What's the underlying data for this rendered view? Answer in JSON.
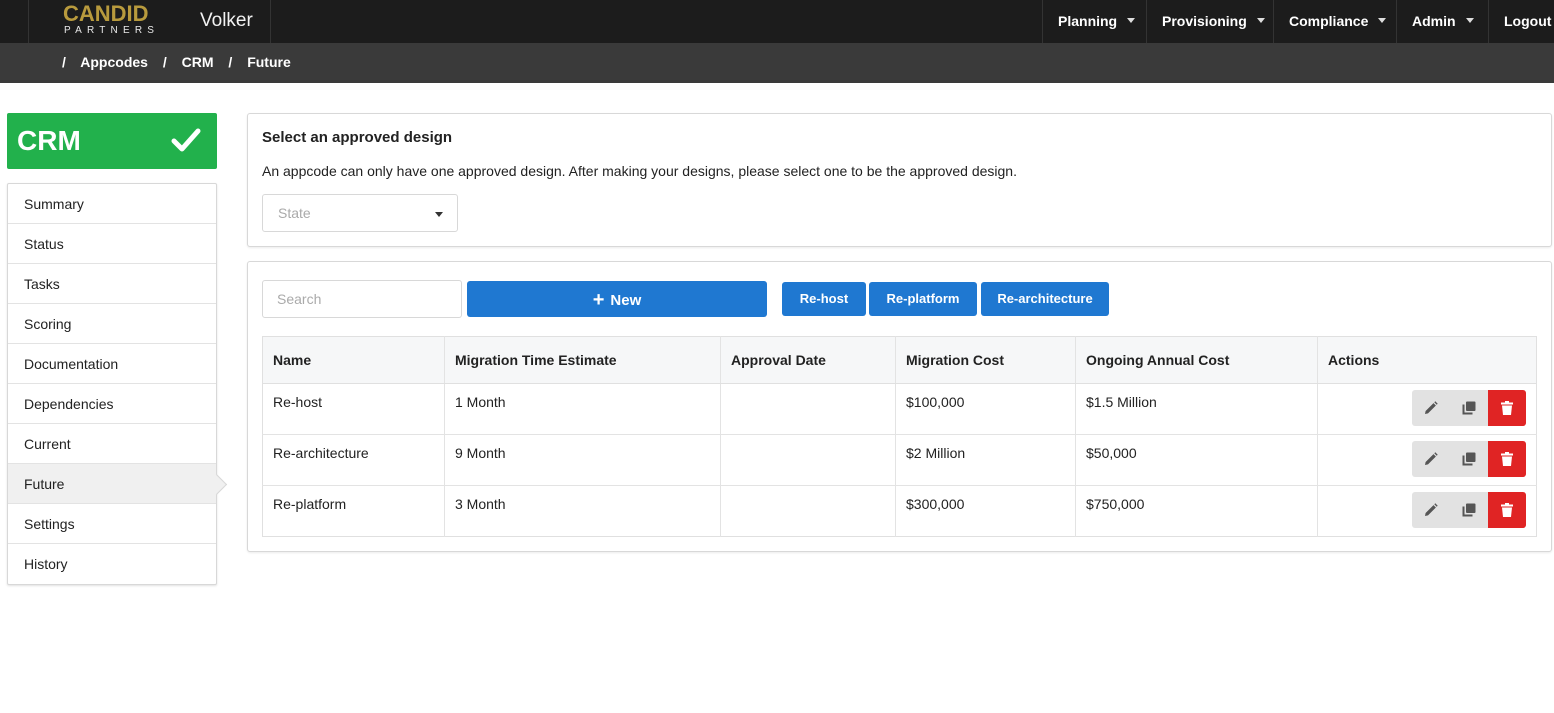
{
  "brand": {
    "logo_top": "CANDID",
    "logo_bottom": "PARTNERS",
    "app_name": "Volker"
  },
  "nav": {
    "items": [
      "Planning",
      "Provisioning",
      "Compliance",
      "Admin"
    ],
    "logout": "Logout"
  },
  "breadcrumb": [
    "Appcodes",
    "CRM",
    "Future"
  ],
  "app_badge": {
    "name": "CRM",
    "status_icon": "check-icon",
    "color": "#22b14c"
  },
  "sidebar": {
    "items": [
      {
        "label": "Summary"
      },
      {
        "label": "Status"
      },
      {
        "label": "Tasks"
      },
      {
        "label": "Scoring"
      },
      {
        "label": "Documentation"
      },
      {
        "label": "Dependencies"
      },
      {
        "label": "Current"
      },
      {
        "label": "Future"
      },
      {
        "label": "Settings"
      },
      {
        "label": "History"
      }
    ],
    "active": "Future"
  },
  "approved_design": {
    "title": "Select an approved design",
    "description": "An appcode can only have one approved design. After making your designs, please select one to be the approved design.",
    "select_placeholder": "State"
  },
  "toolbar": {
    "search_placeholder": "Search",
    "new_label": "New",
    "quick_buttons": [
      "Re-host",
      "Re-platform",
      "Re-architecture"
    ]
  },
  "table": {
    "headers": [
      "Name",
      "Migration Time Estimate",
      "Approval Date",
      "Migration Cost",
      "Ongoing Annual Cost",
      "Actions"
    ],
    "rows": [
      {
        "name": "Re-host",
        "time": "1 Month",
        "approval": "",
        "migration_cost": "$100,000",
        "annual_cost": "$1.5 Million"
      },
      {
        "name": "Re-architecture",
        "time": "9 Month",
        "approval": "",
        "migration_cost": "$2 Million",
        "annual_cost": "$50,000"
      },
      {
        "name": "Re-platform",
        "time": "3 Month",
        "approval": "",
        "migration_cost": "$300,000",
        "annual_cost": "$750,000"
      }
    ]
  },
  "colors": {
    "primary": "#1f78d1",
    "danger": "#e02424",
    "success": "#22b14c",
    "topbar": "#1c1c1c",
    "breadcrumb_bar": "#3a3a3a"
  }
}
